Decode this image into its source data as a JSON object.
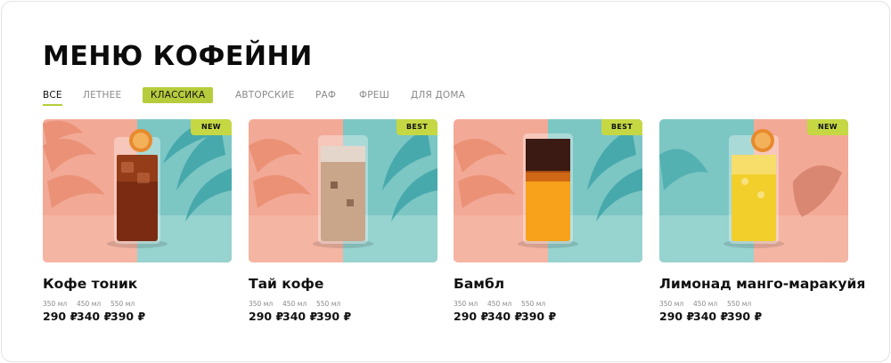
{
  "page": {
    "title": "МЕНЮ КОФЕЙНИ"
  },
  "tabs": [
    {
      "label": "ВСЕ",
      "state": "active"
    },
    {
      "label": "ЛЕТНЕЕ",
      "state": "normal"
    },
    {
      "label": "КЛАССИКА",
      "state": "highlighted"
    },
    {
      "label": "АВТОРСКИЕ",
      "state": "normal"
    },
    {
      "label": "РАФ",
      "state": "normal"
    },
    {
      "label": "ФРЕШ",
      "state": "normal"
    },
    {
      "label": "ДЛЯ ДОМА",
      "state": "normal"
    }
  ],
  "products": [
    {
      "name": "Кофе тоник",
      "badge": "NEW",
      "sizes": [
        {
          "volume": "350 мл",
          "price": "290 ₽"
        },
        {
          "volume": "450 мл",
          "price": "340 ₽"
        },
        {
          "volume": "550 мл",
          "price": "390 ₽"
        }
      ],
      "image": {
        "background": "palm-peach-teal",
        "drink": "coffee-tonic",
        "garnish": "dried-orange-slice"
      }
    },
    {
      "name": "Тай кофе",
      "badge": "BEST",
      "sizes": [
        {
          "volume": "350 мл",
          "price": "290 ₽"
        },
        {
          "volume": "450 мл",
          "price": "340 ₽"
        },
        {
          "volume": "550 мл",
          "price": "390 ₽"
        }
      ],
      "image": {
        "background": "palm-peach-teal",
        "drink": "thai-iced-coffee",
        "garnish": "none"
      }
    },
    {
      "name": "Бамбл",
      "badge": "BEST",
      "sizes": [
        {
          "volume": "350 мл",
          "price": "290 ₽"
        },
        {
          "volume": "450 мл",
          "price": "340 ₽"
        },
        {
          "volume": "550 мл",
          "price": "390 ₽"
        }
      ],
      "image": {
        "background": "palm-peach-teal",
        "drink": "bumble-orange-espresso",
        "garnish": "none"
      }
    },
    {
      "name": "Лимонад манго-маракуйя",
      "badge": "NEW",
      "sizes": [
        {
          "volume": "350 мл",
          "price": "290 ₽"
        },
        {
          "volume": "450 мл",
          "price": "340 ₽"
        },
        {
          "volume": "550 мл",
          "price": "390 ₽"
        }
      ],
      "image": {
        "background": "palm-teal-peach",
        "drink": "mango-passionfruit-lemonade",
        "garnish": "dried-orange-slice"
      }
    }
  ],
  "colors": {
    "accent": "#b7cc3c",
    "badge": "#c5d843",
    "text": "#111111",
    "muted": "#8a8a8a"
  }
}
